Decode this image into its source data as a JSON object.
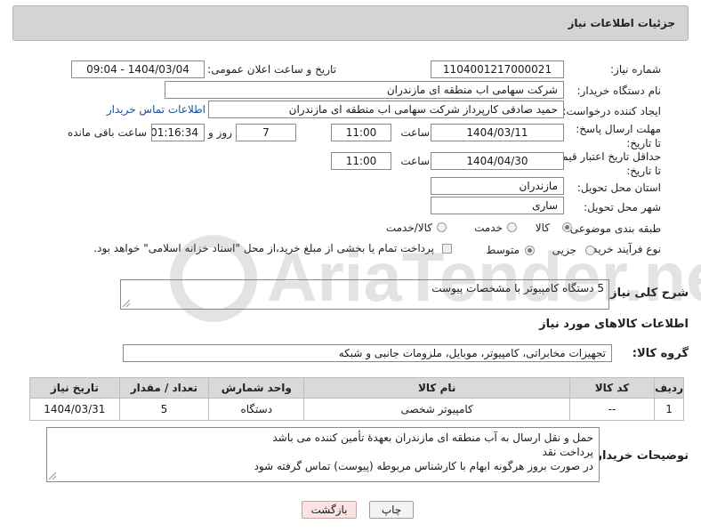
{
  "panel": {
    "title": "جزئیات اطلاعات نیاز"
  },
  "fields": {
    "need_number_label": "شماره نیاز:",
    "need_number": "1104001217000021",
    "announce_label": "تاریخ و ساعت اعلان عمومی:",
    "announce_value": "1404/03/04 - 09:04",
    "buyer_org_label": "نام دستگاه خریدار:",
    "buyer_org": "شرکت سهامی اب منطقه ای مازندران",
    "creator_label": "ایجاد کننده درخواست:",
    "creator": "حمید  صادقی کارپرداز شرکت سهامی اب منطقه ای مازندران",
    "contact_link": "اطلاعات تماس خریدار",
    "deadline_label": "مهلت ارسال پاسخ: تا تاریخ:",
    "deadline_date": "1404/03/11",
    "time_label": "ساعت",
    "deadline_time": "11:00",
    "days_value": "7",
    "days_label": "روز و",
    "remaining_value": "01:16:34",
    "remaining_label": "ساعت باقی مانده",
    "validity_label": "حداقل تاریخ اعتبار قیمت: تا تاریخ:",
    "validity_date": "1404/04/30",
    "validity_time": "11:00",
    "province_label": "استان محل تحویل:",
    "province": "مازندران",
    "city_label": "شهر محل تحویل:",
    "city": "ساری",
    "category_label": "طبقه بندی موضوعی:",
    "category_options": [
      "کالا",
      "خدمت",
      "کالا/خدمت"
    ],
    "process_label": "نوع فرآیند خرید :",
    "process_options": [
      "جزیی",
      "متوسط"
    ],
    "payment_note": "پرداخت تمام یا بخشی از مبلغ خرید،از محل \"اسناد خزانه اسلامی\" خواهد بود."
  },
  "description": {
    "label": "شرح کلی نیاز:",
    "text": "5 دستگاه کامپیوتر با مشخصات پیوست"
  },
  "goods": {
    "section_title": "اطلاعات کالاهای مورد نیاز",
    "group_label": "گروه کالا:",
    "group_value": "تجهیزات مخابراتی، کامپیوتر، موبایل، ملزومات جانبی و شبکه",
    "columns": [
      "ردیف",
      "کد کالا",
      "نام کالا",
      "واحد شمارش",
      "تعداد / مقدار",
      "تاریخ نیاز"
    ],
    "rows": [
      [
        "1",
        "--",
        "کامپیوتر شخصی",
        "دستگاه",
        "5",
        "1404/03/31"
      ]
    ]
  },
  "buyer_notes": {
    "label": "توضیحات خریدار:",
    "lines": [
      "حمل و نقل ارسال به آب منطقه ای مازندران  بعهدهٔ تأمین کننده می باشد",
      "پرداخت نقد",
      "در صورت بروز هرگونه ابهام با کارشناس مربوطه (پیوست) تماس گرفته شود"
    ]
  },
  "buttons": {
    "print": "چاپ",
    "back": "بازگشت"
  },
  "watermark": "AriaTender.neT"
}
